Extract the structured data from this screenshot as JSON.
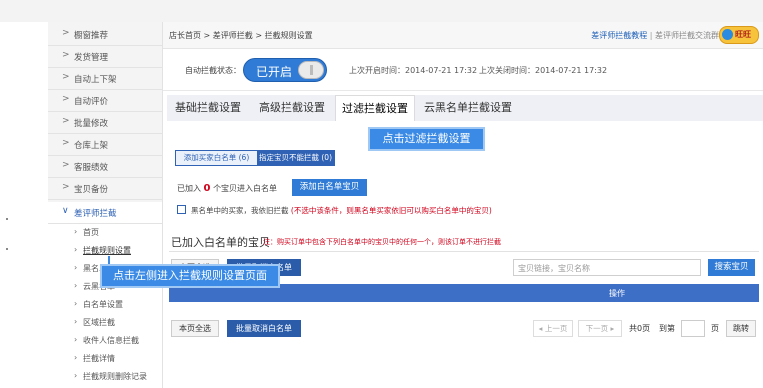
{
  "sidebar": {
    "items": [
      {
        "label": "橱窗推荐"
      },
      {
        "label": "发货管理"
      },
      {
        "label": "自动上下架"
      },
      {
        "label": "自动评价"
      },
      {
        "label": "批量修改"
      },
      {
        "label": "仓库上架"
      },
      {
        "label": "客服绩效"
      },
      {
        "label": "宝贝备份"
      }
    ],
    "group": {
      "label": "差评师拦截",
      "subitems": [
        {
          "label": "首页"
        },
        {
          "label": "拦截规则设置"
        },
        {
          "label": "黑名单"
        },
        {
          "label": "云黑名单"
        },
        {
          "label": "白名单设置"
        },
        {
          "label": "区域拦截"
        },
        {
          "label": "收件人信息拦截"
        },
        {
          "label": "拦截详情"
        },
        {
          "label": "拦截规则删除记录"
        }
      ]
    }
  },
  "header": {
    "breadcrumb": "店长首页 > 差评师拦截 > 拦截规则设置",
    "link_tutorial": "差评师拦截教程",
    "link_group": "差评师拦截交流群",
    "brand_text": "旺旺"
  },
  "status": {
    "label": "自动拦截状态：",
    "toggle_text": "已开启",
    "last_open": "上次开启时间：2014-07-21 17:32",
    "last_close": "上次关闭时间：2014-07-21 17:32"
  },
  "tabs": [
    {
      "label": "基础拦截设置"
    },
    {
      "label": "高级拦截设置"
    },
    {
      "label": "过滤拦截设置"
    },
    {
      "label": "云黑名单拦截设置"
    }
  ],
  "callouts": {
    "top": "点击过滤拦截设置",
    "left": "点击左侧进入拦截规则设置页面"
  },
  "filter": {
    "left": "添加买家白名单 (6)",
    "right": "指定宝贝不能拦截 (0)"
  },
  "added": {
    "prefix": "已加入",
    "count": "0",
    "suffix": "个宝贝进入白名单",
    "button": "添加白名单宝贝"
  },
  "blacklist_option": {
    "text": "黑名单中的买家，我依旧拦截",
    "note": "(不选中该条件，则黑名单买家依旧可以购买白名单中的宝贝)"
  },
  "section": {
    "title": "已加入白名单的宝贝",
    "note": "注：购买订单中包含下列白名单中的宝贝中的任何一个，则该订单不进行拦截"
  },
  "toolbar": {
    "select_all": "本页全选",
    "batch_cancel": "批量取消白名单",
    "search_placeholder": "宝贝链接，宝贝名称",
    "search_button": "搜索宝贝"
  },
  "table": {
    "op_header": "操作"
  },
  "pager": {
    "prev": "◂ 上一页",
    "next": "下一页 ▸",
    "total": "共0页",
    "goto": "到第",
    "page_unit": "页",
    "jump": "跳转"
  }
}
